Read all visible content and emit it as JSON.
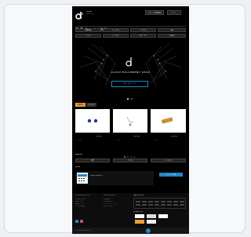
{
  "header": {
    "brand_line1": "SOUND",
    "brand_line2": "NEOTECH",
    "login_label": "ログイン/新規登録",
    "cart_label": "カート"
  },
  "toolbar": {
    "menu_icon": "menu-icon",
    "search_icon": "search-icon",
    "user_icon": "user-icon",
    "cart_icon": "cart-icon"
  },
  "nav": {
    "buttons": [
      "新着商品",
      "ヘッドホン",
      "イヤホン",
      "DAP",
      "アンプ",
      "ケーブル",
      "スピーカー",
      "中古品"
    ]
  },
  "hero": {
    "headline": "AUDIO EQUIPMENT SHOP",
    "cta_label": "商品一覧はこちら"
  },
  "tabs": [
    "新着商品",
    "おすすめ"
  ],
  "products": [
    {
      "price": "¥00,000",
      "tag": "イヤホン"
    },
    {
      "price": "¥00,000",
      "tag": "ケーブル"
    },
    {
      "price": "¥00,000",
      "tag": "ケーブル"
    }
  ],
  "ranking": {
    "title": "RANKING",
    "buttons": [
      "総合",
      "イヤホン",
      "ヘッドホン"
    ]
  },
  "news": {
    "title": "NEWS",
    "item_text": "営業日のお知らせ",
    "button_label": "ニュース一覧"
  },
  "footer": {
    "col1_title": "ショッピングガイド",
    "col1_items": [
      "お支払い方法",
      "配送について",
      "返品について",
      "よくある質問"
    ],
    "col2_title": "ショップについて",
    "col2_items": [
      "会社概要",
      "特定商取引法",
      "プライバシーポリシー",
      "お問い合わせ"
    ],
    "col3_title": "営業日カレンダー",
    "payment_title": "お支払い方法",
    "copyright": "© SOUND NEOTECH"
  },
  "colors": {
    "accent": "#1e88c8",
    "background": "#000000",
    "card": "#f7f8fa",
    "orange": "#f0a030"
  }
}
